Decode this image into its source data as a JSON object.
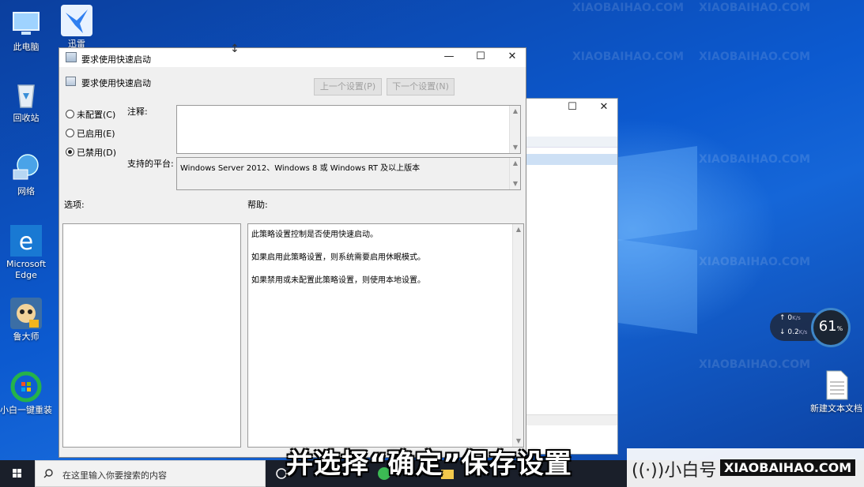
{
  "desktop": {
    "icons": [
      {
        "label": "此电脑"
      },
      {
        "label": "回收站"
      },
      {
        "label": "网络"
      },
      {
        "label": "Microsoft Edge"
      },
      {
        "label": "鲁大师"
      },
      {
        "label": "小白一键重装"
      },
      {
        "label": "迅雷"
      },
      {
        "label": "新建文本文档"
      }
    ]
  },
  "dialog": {
    "title": "要求使用快速启动",
    "setting_name": "要求使用快速启动",
    "prev_button": "上一个设置(P)",
    "next_button": "下一个设置(N)",
    "radios": [
      {
        "label": "未配置(C)",
        "selected": false
      },
      {
        "label": "已启用(E)",
        "selected": false
      },
      {
        "label": "已禁用(D)",
        "selected": true
      }
    ],
    "comment_label": "注释:",
    "platform_label": "支持的平台:",
    "platform_value": "Windows Server 2012、Windows 8 或 Windows RT 及以上版本",
    "options_label": "选项:",
    "help_label": "帮助:",
    "help_lines": [
      "此策略设置控制是否使用快速启动。",
      "如果启用此策略设置，则系统需要启用休眠模式。",
      "如果禁用或未配置此策略设置，则使用本地设置。"
    ]
  },
  "taskbar": {
    "search_placeholder": "在这里输入你要搜索的内容"
  },
  "speed_widget": {
    "upload_value": "0",
    "upload_unit": "K/s",
    "download_value": "0.2",
    "download_unit": "K/s",
    "percent": "61",
    "percent_unit": "%"
  },
  "subtitle": "并选择“确定”保存设置",
  "brand": {
    "name": "((·))小白号",
    "url": "XIAOBAIHAO.COM"
  },
  "colors": {
    "desktop_blue": "#0c5ad0",
    "taskbar": "#1a1f2a",
    "accent": "#3e86c9"
  }
}
